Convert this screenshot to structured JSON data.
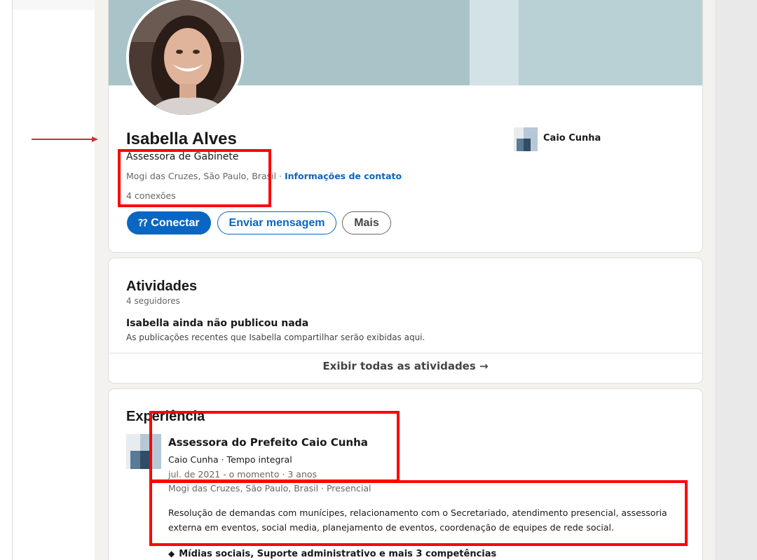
{
  "profile": {
    "name": "Isabella Alves",
    "headline": "Assessora de Gabinete",
    "location": "Mogi das Cruzes, São Paulo, Brasil",
    "location_separator": " · ",
    "contact_info_link": "Informações de contato",
    "connections": "4 conexões",
    "current_company": "Caio Cunha",
    "actions": {
      "connect": "Conectar",
      "message": "Enviar mensagem",
      "more": "Mais"
    },
    "connect_icon": "add-person-icon"
  },
  "activity": {
    "title": "Atividades",
    "followers": "4 seguidores",
    "empty_title": "Isabella ainda não publicou nada",
    "empty_description": "As publicações recentes que Isabella compartilhar serão exibidas aqui.",
    "show_all": "Exibir todas as atividades →"
  },
  "experience": {
    "title": "Experiência",
    "items": [
      {
        "title": "Assessora do Prefeito Caio Cunha",
        "company": "Caio Cunha · Tempo integral",
        "dates": "jul. de 2021 - o momento · 3 anos",
        "location": "Mogi das Cruzes, São Paulo, Brasil · Presencial",
        "description": "Resolução de demandas com munícipes, relacionamento com o Secretariado, atendimento presencial, assessoria externa em eventos, social media, planejamento de eventos, coordenação de equipes de rede social.",
        "skills": "Mídias sociais, Suporte administrativo e mais 3 competências",
        "skills_icon": "diamond-icon"
      }
    ]
  },
  "colors": {
    "primary": "#0a66c2",
    "annotation": "#ff0000",
    "arrow": "#c0392b"
  }
}
